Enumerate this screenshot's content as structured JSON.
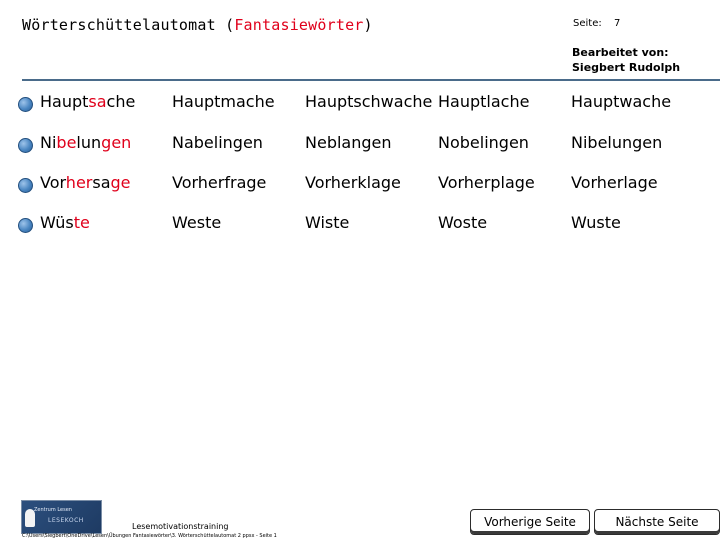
{
  "header": {
    "title_prefix": "Wörterschüttelautomat (",
    "title_highlight": "Fantasiewörter",
    "title_suffix": ")",
    "seite_label": "Seite:",
    "seite_number": "7",
    "edited_label": "Bearbeitet von:",
    "edited_name": "Siegbert Rudolph"
  },
  "rows": [
    {
      "first": {
        "pre": "Haupt",
        "hl": "sa",
        "post": "che"
      },
      "others": [
        "Hauptmache",
        "Hauptschwache",
        "Hauptlache",
        "Hauptwache"
      ]
    },
    {
      "first": {
        "pre": "Ni",
        "hl": "be",
        "post": "lun",
        "hl2": "gen"
      },
      "others": [
        "Nabelingen",
        "Neblangen",
        "Nobelingen",
        "Nibelungen"
      ]
    },
    {
      "first": {
        "pre": "Vor",
        "hl": "her",
        "post": "sa",
        "hl2": "ge"
      },
      "others": [
        "Vorherfrage",
        "Vorherklage",
        "Vorherplage",
        "Vorherlage"
      ]
    },
    {
      "first": {
        "pre": "Wüs",
        "hl": "te",
        "post": ""
      },
      "others": [
        "Weste",
        "Wiste",
        "Woste",
        "Wuste"
      ]
    }
  ],
  "footer": {
    "logo_line1": "Zentrum Lesen",
    "logo_line2": "LESEKOCH",
    "training": "Lesemotivationstraining",
    "path": "C:\\Users\\Siegbert\\OneDrive\\Lesen\\Übungen Fantasiewörter\\3. Wörterschüttelautomat 2 ppsx - Seite 1",
    "prev_button": "Vorherige Seite",
    "next_button": "Nächste Seite"
  },
  "colors": {
    "highlight": "#e0001b",
    "rule": "#4a6b8a",
    "bullet": "#4a86c2"
  }
}
